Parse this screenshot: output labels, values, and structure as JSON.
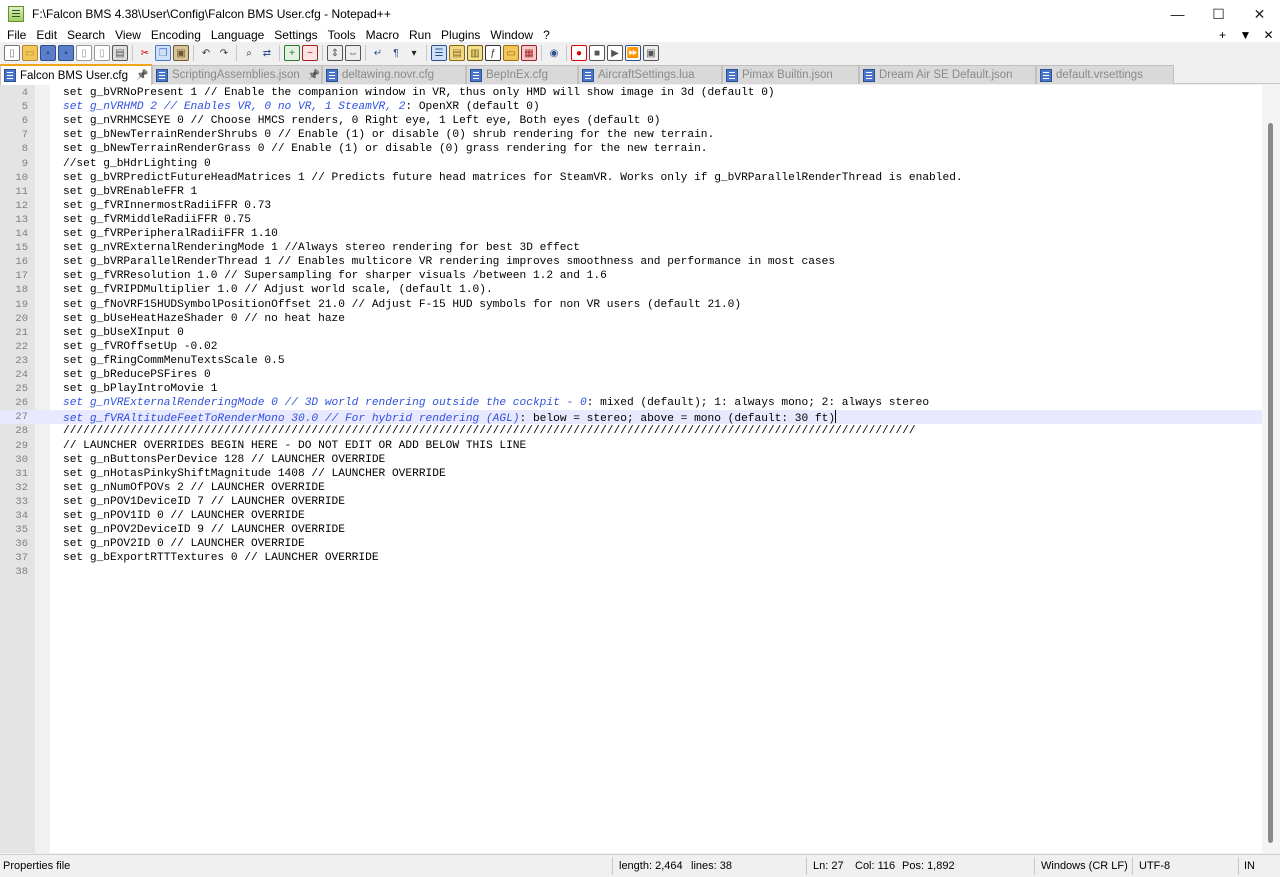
{
  "window": {
    "title": "F:\\Falcon BMS 4.38\\User\\Config\\Falcon BMS User.cfg - Notepad++",
    "controls": {
      "minimize": "—",
      "maximize": "☐",
      "close": "✕"
    }
  },
  "menu": {
    "items": [
      "File",
      "Edit",
      "Search",
      "View",
      "Encoding",
      "Language",
      "Settings",
      "Tools",
      "Macro",
      "Run",
      "Plugins",
      "Window",
      "?"
    ],
    "right": {
      "add": "+",
      "dropdown": "▼",
      "close": "✕"
    }
  },
  "toolbar": {
    "icons": [
      "new-file-icon",
      "open-file-icon",
      "save-icon",
      "save-all-icon",
      "close-file-icon",
      "close-all-icon",
      "print-icon",
      "sep",
      "cut-icon",
      "copy-icon",
      "paste-icon",
      "sep",
      "undo-icon",
      "redo-icon",
      "sep",
      "find-icon",
      "replace-icon",
      "sep",
      "zoom-in-icon",
      "zoom-out-icon",
      "sep",
      "sync-vertical-icon",
      "sync-horizontal-icon",
      "sep",
      "word-wrap-icon",
      "show-all-chars-icon",
      "dropdown-icon",
      "sep",
      "indent-guide-icon",
      "user-language-icon",
      "doc-map-icon",
      "function-list-icon",
      "folder-workspace-icon",
      "document-list-icon",
      "sep",
      "monitoring-icon",
      "sep",
      "record-macro-icon",
      "stop-macro-icon",
      "play-macro-icon",
      "run-macro-multiple-icon",
      "save-macro-icon"
    ]
  },
  "tabs": [
    {
      "label": "Falcon BMS User.cfg",
      "active": true,
      "pinned": true,
      "close": "✕"
    },
    {
      "label": "ScriptingAssemblies.json",
      "pinned": true
    },
    {
      "label": "deltawing.novr.cfg"
    },
    {
      "label": "BepInEx.cfg"
    },
    {
      "label": "AircraftSettings.lua"
    },
    {
      "label": "Pimax Builtin.json"
    },
    {
      "label": "Dream Air SE Default.json"
    },
    {
      "label": "default.vrsettings"
    }
  ],
  "editor": {
    "first_line_number": 4,
    "current_line": 27,
    "lines": [
      {
        "text": "set g_bVRNoPresent 1 // Enable the companion window in VR, thus only HMD will show image in 3d (default 0)"
      },
      {
        "pre": "set g_nVRHMD 2 // Enables VR, 0 no VR, 1 SteamVR, 2",
        "text": ": OpenXR (default 0)"
      },
      {
        "text": "set g_nVRHMCSEYE 0 // Choose HMCS renders, 0 Right eye, 1 Left eye, Both eyes (default 0)"
      },
      {
        "text": "set g_bNewTerrainRenderShrubs 0 // Enable (1) or disable (0) shrub rendering for the new terrain."
      },
      {
        "text": "set g_bNewTerrainRenderGrass 0 // Enable (1) or disable (0) grass rendering for the new terrain."
      },
      {
        "text": "//set g_bHdrLighting 0"
      },
      {
        "text": "set g_bVRPredictFutureHeadMatrices 1 // Predicts future head matrices for SteamVR. Works only if g_bVRParallelRenderThread is enabled."
      },
      {
        "text": "set g_bVREnableFFR 1"
      },
      {
        "text": "set g_fVRInnermostRadiiFFR 0.73"
      },
      {
        "text": "set g_fVRMiddleRadiiFFR 0.75"
      },
      {
        "text": "set g_fVRPeripheralRadiiFFR 1.10"
      },
      {
        "text": "set g_nVRExternalRenderingMode 1 //Always stereo rendering for best 3D effect"
      },
      {
        "text": "set g_bVRParallelRenderThread 1 // Enables multicore VR rendering improves smoothness and performance in most cases"
      },
      {
        "text": "set g_fVRResolution 1.0 // Supersampling for sharper visuals /between 1.2 and 1.6"
      },
      {
        "text": "set g_fVRIPDMultiplier 1.0 // Adjust world scale, (default 1.0)."
      },
      {
        "text": "set g_fNoVRF15HUDSymbolPositionOffset 21.0 // Adjust F-15 HUD symbols for non VR users (default 21.0)"
      },
      {
        "text": "set g_bUseHeatHazeShader 0 // no heat haze"
      },
      {
        "text": "set g_bUseXInput 0"
      },
      {
        "text": "set g_fVROffsetUp -0.02"
      },
      {
        "text": "set g_fRingCommMenuTextsScale 0.5"
      },
      {
        "text": "set g_bReducePSFires 0"
      },
      {
        "text": "set g_bPlayIntroMovie 1"
      },
      {
        "pre": "set g_nVRExternalRenderingMode 0 // 3D world rendering outside the cockpit - 0",
        "text": ": mixed (default); 1: always mono; 2: always stereo"
      },
      {
        "pre": "set g_fVRAltitudeFeetToRenderMono 30.0 // For hybrid rendering (AGL)",
        "text": ": below = stereo; above = mono (default: 30 ft)"
      },
      {
        "text": "///////////////////////////////////////////////////////////////////////////////////////////////////////////////////////////////"
      },
      {
        "text": "// LAUNCHER OVERRIDES BEGIN HERE - DO NOT EDIT OR ADD BELOW THIS LINE"
      },
      {
        "text": "set g_nButtonsPerDevice 128 // LAUNCHER OVERRIDE"
      },
      {
        "text": "set g_nHotasPinkyShiftMagnitude 1408 // LAUNCHER OVERRIDE"
      },
      {
        "text": "set g_nNumOfPOVs 2 // LAUNCHER OVERRIDE"
      },
      {
        "text": "set g_nPOV1DeviceID 7 // LAUNCHER OVERRIDE"
      },
      {
        "text": "set g_nPOV1ID 0 // LAUNCHER OVERRIDE"
      },
      {
        "text": "set g_nPOV2DeviceID 9 // LAUNCHER OVERRIDE"
      },
      {
        "text": "set g_nPOV2ID 0 // LAUNCHER OVERRIDE"
      },
      {
        "text": "set g_bExportRTTTextures 0 // LAUNCHER OVERRIDE"
      },
      {
        "text": ""
      }
    ]
  },
  "status": {
    "file_type": "Properties file",
    "length": "length: 2,464",
    "lines": "lines: 38",
    "ln": "Ln: 27",
    "col": "Col: 116",
    "pos": "Pos: 1,892",
    "eol": "Windows (CR LF)",
    "encoding": "UTF-8",
    "mode": "IN"
  },
  "colors": {
    "accent_tab": "#f5a21d",
    "vr_highlight_text": "#3050e0",
    "current_line_bg": "#e8e8ff"
  }
}
